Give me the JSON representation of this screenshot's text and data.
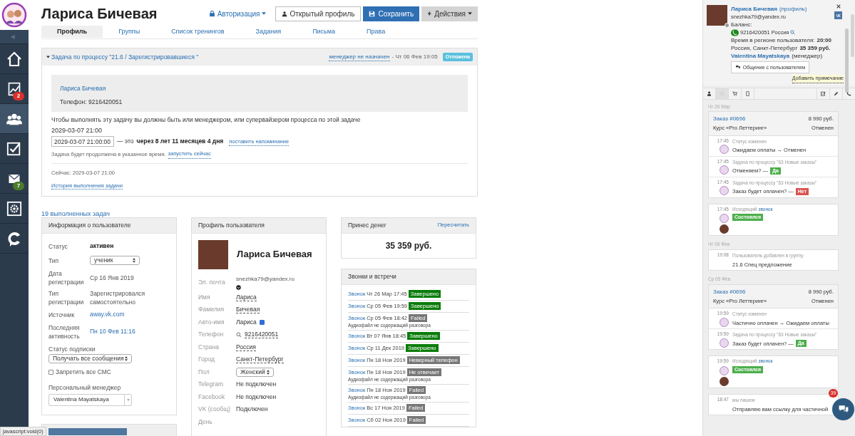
{
  "nav": {
    "items": [
      {
        "kind": "speaker",
        "selected": false
      },
      {
        "kind": "home",
        "selected": false
      },
      {
        "kind": "chart",
        "selected": false,
        "badge": "2",
        "color": "#d9302c"
      },
      {
        "kind": "users",
        "selected": true
      },
      {
        "kind": "tasks",
        "selected": false
      },
      {
        "kind": "mail",
        "selected": false,
        "badge": "7",
        "color": "#4a7a2a"
      },
      {
        "kind": "settings",
        "selected": false
      },
      {
        "kind": "brand",
        "selected": false
      }
    ]
  },
  "header": {
    "title": "Лариса Бичевая",
    "auth": "Авторизация",
    "open_profile": "Открытый профиль",
    "save": "Сохранить",
    "actions": "Действия"
  },
  "tabs": [
    {
      "label": "Профиль",
      "selected": true
    },
    {
      "label": "Группы",
      "selected": false
    },
    {
      "label": "Список тренингов",
      "selected": false
    },
    {
      "label": "Задания",
      "selected": false
    },
    {
      "label": "Письма",
      "selected": false
    },
    {
      "label": "Права",
      "selected": false
    }
  ],
  "task": {
    "title": "Задача по процессу \"21.6 / Зарегистрировавшиеся \"",
    "manager": "менеджер не назначен",
    "date": "- Чт 06 Фев 19:05",
    "status": "Отложена",
    "contact_name": "Лариса Бичевая",
    "phone": "Телефон: 9216420051",
    "notice": "Чтобы выполнять эту задачу вы должны быть или менеджером, или супервайзером процесса по этой задаче",
    "datetime": "2029-03-07 21:00",
    "input_value": "2029-03-07 21:00:00",
    "relative_prefix": "— это",
    "relative": "через 8 лет 11 месяцев 4 дня",
    "remind": "поставить напоминание",
    "continue_text": "Задача будет продолжена в указанное время.",
    "run_now": "запустить сейчас",
    "now": "Сейчас: 2029-03-07 21:00",
    "history": "История выполнения задачи"
  },
  "completed_link": "19 выполненных задач",
  "user_info": {
    "title": "Информация о пользователе",
    "rows": [
      {
        "label": "Статус",
        "value": "активен",
        "kind": "bold"
      },
      {
        "label": "Тип",
        "value": "ученик",
        "kind": "select"
      },
      {
        "label": "Дата регистрации",
        "value": "Ср 16 Янв 2019",
        "kind": "text"
      },
      {
        "label": "Тип регистрации",
        "value": "Зарегистрировался самостоятельно",
        "kind": "text"
      },
      {
        "label": "Источник",
        "value": "away.vk.com",
        "kind": "link"
      },
      {
        "label": "Последняя активность",
        "value": "Пн 10 Фев 11:16",
        "kind": "link"
      }
    ],
    "subscription_label": "Статус подписки",
    "subscription_value": "Получать все сообщения",
    "sms_label": "Запретить все СМС",
    "sms_checked": false,
    "manager_label": "Персональный менеджер",
    "manager_value": "Valentina Mayatskaya"
  },
  "profile": {
    "title": "Профиль пользователя",
    "name": "Лариса Бичевая",
    "rows": [
      {
        "label": "Эл. почта",
        "value": "snezhka79@yandex.ru",
        "kind": "email"
      },
      {
        "label": "Имя",
        "value": "Лариса",
        "kind": "dashed"
      },
      {
        "label": "Фамилия",
        "value": "Бичевая",
        "kind": "dashed"
      },
      {
        "label": "Авто-имя",
        "value": "Лариса",
        "kind": "checkbox",
        "checked": true
      },
      {
        "label": "Телефон",
        "value": "9216420051",
        "kind": "phone"
      },
      {
        "label": "Страна",
        "value": "Россия",
        "kind": "dashed"
      },
      {
        "label": "Город",
        "value": "Санкт-Петербург",
        "kind": "dashed"
      },
      {
        "label": "Пол",
        "value": "Женский",
        "kind": "select"
      },
      {
        "label": "Telegram",
        "value": "Не подключен",
        "kind": "text"
      },
      {
        "label": "Facebook",
        "value": "Не подключен",
        "kind": "text"
      },
      {
        "label": "VK (сообщ)",
        "value": "Подключен",
        "kind": "text"
      },
      {
        "label": "День",
        "kind": "text"
      }
    ]
  },
  "money": {
    "title": "Принес денег",
    "recalc": "Пересчитать",
    "amount": "35 359 руб."
  },
  "calls": {
    "title": "Звонки и встречи",
    "rows": [
      {
        "link": "Звонок",
        "date": "Чт 26 Мар 17:45",
        "status": "Завершено",
        "color": "#0a7d0a"
      },
      {
        "link": "Звонок",
        "date": "Ср 05 Фев 19:59",
        "status": "Завершено",
        "color": "#0a7d0a"
      },
      {
        "link": "Звонок",
        "date": "Ср 05 Фев 18:42",
        "status": "Failed",
        "color": "#777777",
        "note": "Аудиофайл не содержащий разговора"
      },
      {
        "link": "Звонок",
        "date": "Вт 07 Янв 18:45",
        "status": "Завершено",
        "color": "#0a7d0a"
      },
      {
        "link": "Звонок",
        "date": "Ср 11 Дек 2019",
        "status": "Завершено",
        "color": "#0a7d0a"
      },
      {
        "link": "Звонок",
        "date": "Пн 18 Ноя 2019",
        "status": "Неверный телефон",
        "color": "#777777"
      },
      {
        "link": "Звонок",
        "date": "Пн 18 Ноя 2019",
        "status": "Не отвечает",
        "color": "#777777",
        "note": "Аудиофайл не содержащий разговора"
      },
      {
        "link": "Звонок",
        "date": "Пн 18 Ноя 2019",
        "status": "Failed",
        "color": "#777777",
        "note": "Аудиофайл не содержащий разговора"
      },
      {
        "link": "Звонок",
        "date": "Вс 17 Ноя 2019",
        "status": "Failed",
        "color": "#777777"
      },
      {
        "link": "Звонок",
        "date": "Сб 02 Ноя 2019",
        "status": "Failed",
        "color": "#777777"
      }
    ]
  },
  "sidebar": {
    "name": "Лариса Бичевая",
    "profile_link": "(профиль)",
    "email": "snezhka79@yandex.ru",
    "balance": "Баланс:",
    "phone": "9216420051 Россия",
    "region_label": "Время в регионе пользователя:",
    "region_time": "20:00",
    "location": "Россия, Санкт-Петербург",
    "amount": "35 359 руб.",
    "manager": "Valentina Mayatskaya",
    "manager_role": "(менеджер)",
    "chat_button": "Общение с пользователем",
    "add_note": "Добавить примечание",
    "tabs": [
      {
        "selected": false
      },
      {
        "selected": true
      },
      {
        "selected": false
      },
      {
        "selected": false
      },
      {
        "selected": false
      },
      {
        "selected": false
      },
      {
        "selected": false
      }
    ],
    "feed": [
      {
        "date": "Чт 26 Мар",
        "cards": [
          {
            "kind": "order",
            "order": "Заказ #0696",
            "price": "8 990 руб.",
            "course": "Курс «Pro Леттеринг»",
            "state": "Отменен",
            "events": [
              {
                "time": "17:45",
                "title": "Статус изменен",
                "text": "Ожидаем оплаты → Отменен"
              },
              {
                "time": "17:45",
                "title": "Задача по процессу \"63 Новые заказы\"",
                "text": "Отменяем? —",
                "answer": "Да",
                "color": "#4cae4c"
              },
              {
                "time": "17:45",
                "title": "Задача по процессу \"63 Новые заказы\"",
                "text": "Заказ будет оплачен? —",
                "answer": "Нет",
                "color": "#d9534f"
              }
            ]
          },
          {
            "kind": "call",
            "time": "17:45",
            "prefix": "Исходящий",
            "link": "звонок",
            "status": "Состоялся"
          }
        ]
      },
      {
        "date": "Чт 06 Фев",
        "cards": [
          {
            "kind": "event",
            "time": "19:08",
            "title": "Пользователь добавлен в группу",
            "text": "21.6 Спец предложение"
          }
        ]
      },
      {
        "date": "Ср 05 Фев",
        "cards": [
          {
            "kind": "order",
            "order": "Заказ #0696",
            "price": "8 990 руб.",
            "course": "Курс «Pro Леттеринг»",
            "state": "Отменен",
            "events": [
              {
                "time": "19:59",
                "title": "Статус изменен",
                "text": "Частично оплачен → Ожидаем оплаты"
              },
              {
                "time": "19:59",
                "title": "Задача по процессу \"63 Новые заказы\"",
                "text": "Заказ будет оплачен? —",
                "answer": "Да",
                "color": "#4cae4c"
              }
            ]
          },
          {
            "kind": "call",
            "time": "19:59",
            "prefix": "Исходящий",
            "link": "звонок",
            "status": "Состоялся"
          },
          {
            "kind": "event",
            "time": "18:47",
            "title": "мы пишем",
            "text": "Отправляю вам ссылку для частичной"
          }
        ]
      }
    ]
  },
  "chat_badge": "39",
  "status_url": "javascript:void(0)"
}
